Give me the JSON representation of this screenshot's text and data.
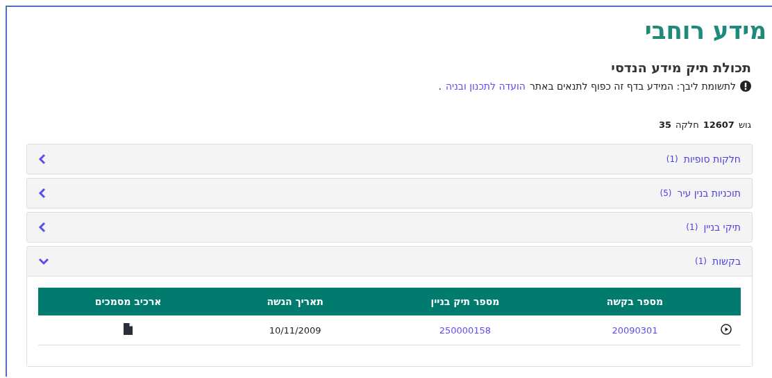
{
  "page_title": "מידע רוחבי",
  "section_title": "תכולת תיק מידע הנדסי",
  "notice": {
    "text": "לתשומת ליבך: המידע בדף זה כפוף לתנאים באתר",
    "link": "הועדה לתכנון ובניה",
    "end": "."
  },
  "parcel": {
    "gush_label": "גוש",
    "gush": "12607",
    "helka_label": "חלקה",
    "helka": "35"
  },
  "accordion": [
    {
      "title": "חלקות סופיות",
      "count": "(1)",
      "expanded": false
    },
    {
      "title": "תוכניות בנין עיר",
      "count": "(5)",
      "expanded": false
    },
    {
      "title": "תיקי בניין",
      "count": "(1)",
      "expanded": false
    },
    {
      "title": "בקשות",
      "count": "(1)",
      "expanded": true,
      "table": {
        "columns": [
          "מספר בקשה",
          "מספר תיק בניין",
          "תאריך הגשה",
          "ארכיב מסמכים"
        ],
        "rows": [
          {
            "cells": [
              {
                "kind": "link",
                "text": "20090301"
              },
              {
                "kind": "link",
                "text": "250000158"
              },
              {
                "kind": "text",
                "text": "10/11/2009"
              },
              {
                "kind": "file"
              }
            ]
          }
        ]
      }
    }
  ]
}
